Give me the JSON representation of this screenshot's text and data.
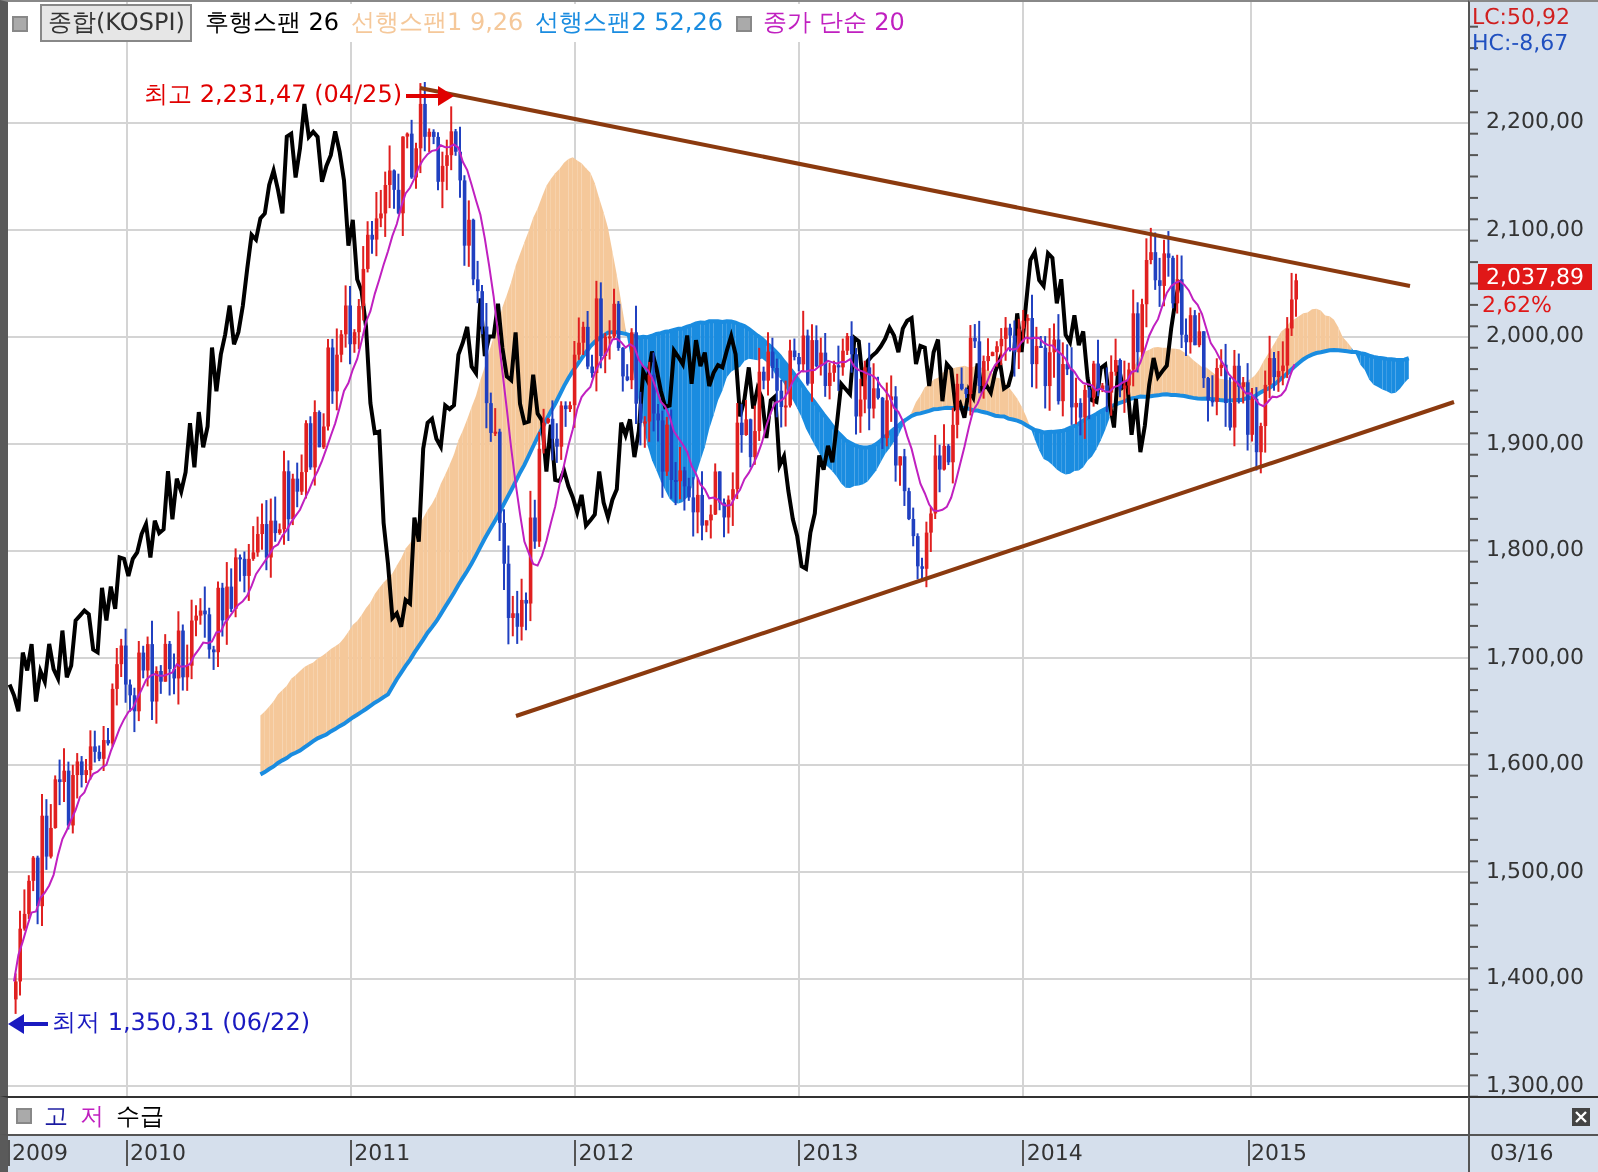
{
  "legend": [
    {
      "label": "종합(KOSPI)",
      "kind": "symbol",
      "color": "#333333"
    },
    {
      "label": "후행스팬 26",
      "kind": "series",
      "color": "#000000"
    },
    {
      "label": "선행스팬1 9,26",
      "kind": "series",
      "color": "#f5c89a"
    },
    {
      "label": "선행스팬2 52,26",
      "kind": "series",
      "color": "#1a8ce0"
    },
    {
      "label": "종가 단순 20",
      "kind": "series-marked",
      "color": "#c020c0"
    }
  ],
  "annotations": [
    {
      "kind": "high",
      "text": "최고 2,231,47 (04/25)"
    },
    {
      "kind": "low",
      "text": "최저 1,350,31 (06/22)"
    }
  ],
  "right_axis": {
    "lc": "LC:50,92",
    "hc": "HC:-8,67",
    "price": "2,037,89",
    "change": "2,62%",
    "ticks": [
      "2,200,00",
      "2,100,00",
      "2,000,00",
      "1,900,00",
      "1,800,00",
      "1,700,00",
      "1,600,00",
      "1,500,00",
      "1,400,00",
      "1,300,00"
    ]
  },
  "sub_panel": {
    "legend": [
      {
        "label": "고",
        "color": "#1a1aa0"
      },
      {
        "label": "저",
        "color": "#c020c0"
      },
      {
        "label": "수급",
        "color": "#000000"
      }
    ]
  },
  "x_axis": {
    "labels": [
      "2009",
      "2010",
      "2011",
      "2012",
      "2013",
      "2014",
      "2015"
    ],
    "current_date": "03/16"
  }
}
